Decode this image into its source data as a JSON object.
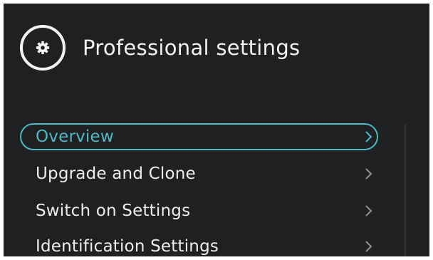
{
  "header": {
    "icon": "gear-icon",
    "title": "Professional settings"
  },
  "menu": {
    "items": [
      {
        "label": "Overview",
        "icon": "chevron-right-icon",
        "selected": true
      },
      {
        "label": "Upgrade and Clone",
        "icon": "chevron-right-icon",
        "selected": false
      },
      {
        "label": "Switch on Settings",
        "icon": "chevron-right-icon",
        "selected": false
      },
      {
        "label": "Identification Settings",
        "icon": "chevron-right-icon",
        "selected": false
      }
    ]
  },
  "colors": {
    "background": "#1f2021",
    "text": "#ececec",
    "accent": "#4fb9c4",
    "divider": "#34363a"
  }
}
